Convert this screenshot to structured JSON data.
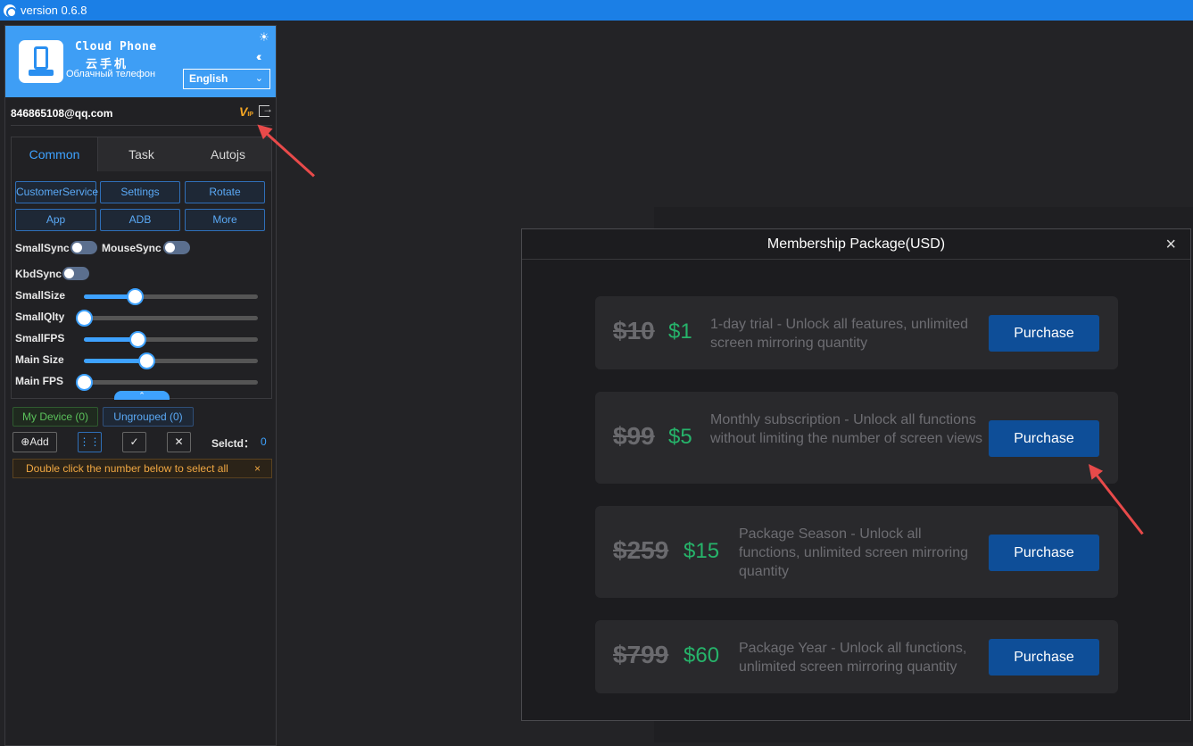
{
  "window": {
    "title": "version 0.6.8"
  },
  "brand": {
    "name": "Cloud Phone",
    "name_cn": "云手机",
    "name_ru": "Облачный телефон"
  },
  "language": {
    "selected": "English"
  },
  "account": {
    "email": "846865108@qq.com",
    "vip_label": "V",
    "vip_sub": "IP"
  },
  "tabs": [
    {
      "label": "Common"
    },
    {
      "label": "Task"
    },
    {
      "label": "Autojs"
    }
  ],
  "buttons": {
    "customer_service": "CustomerService",
    "settings": "Settings",
    "rotate": "Rotate",
    "app": "App",
    "adb": "ADB",
    "more": "More"
  },
  "toggles": {
    "small_sync": "SmallSync",
    "mouse_sync": "MouseSync",
    "kbd_sync": "KbdSync"
  },
  "sliders": [
    {
      "label": "SmallSize",
      "value": 0.29
    },
    {
      "label": "SmallQlty",
      "value": 0.0
    },
    {
      "label": "SmallFPS",
      "value": 0.31
    },
    {
      "label": "Main Size",
      "value": 0.36
    },
    {
      "label": "Main FPS",
      "value": 0.0
    }
  ],
  "groups": {
    "my_device": "My Device (0)",
    "ungrouped": "Ungrouped (0)"
  },
  "toolbar": {
    "add": "Add",
    "selected_label": "Selctd：",
    "selected_count": "0"
  },
  "notice": {
    "text": "Double click the number below to select all",
    "close": "×"
  },
  "modal": {
    "title": "Membership Package(USD)",
    "close": "×",
    "packages": [
      {
        "old_price": "$10",
        "new_price": "$1",
        "description": "1-day trial - Unlock all features, unlimited screen mirroring quantity",
        "button": "Purchase"
      },
      {
        "old_price": "$99",
        "new_price": "$5",
        "description": "Monthly subscription - Unlock all functions without limiting the number of screen views",
        "button": "Purchase"
      },
      {
        "old_price": "$259",
        "new_price": "$15",
        "description": "Package Season - Unlock all functions, unlimited screen mirroring quantity",
        "button": "Purchase"
      },
      {
        "old_price": "$799",
        "new_price": "$60",
        "description": "Package Year - Unlock all functions, unlimited screen mirroring quantity",
        "button": "Purchase"
      }
    ]
  },
  "colors": {
    "accent": "#3ea2ff",
    "titlebar": "#1b7fe6",
    "price_new": "#26b36a",
    "purchase": "#0e4e98",
    "annotation": "#e84a4a"
  }
}
